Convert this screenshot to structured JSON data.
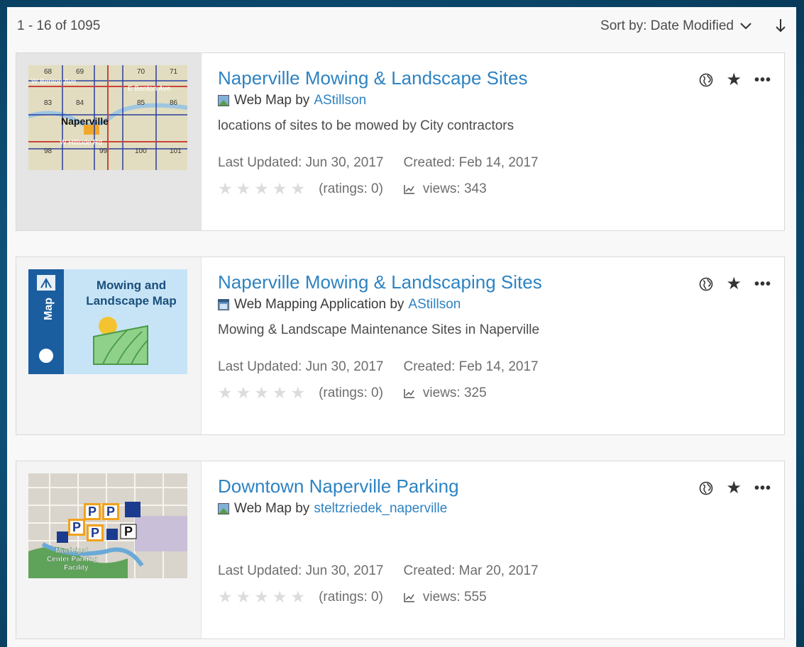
{
  "header": {
    "count": "1 - 16 of 1095",
    "sort_label": "Sort by: Date Modified"
  },
  "items": [
    {
      "title": "Naperville Mowing & Landscape Sites",
      "type": "Web Map by",
      "owner": "AStillson",
      "description": "locations of sites to be mowed by City contractors",
      "updated": "Last Updated: Jun 30, 2017",
      "created": "Created: Feb 14, 2017",
      "stars": "★★★★★",
      "ratings": "(ratings: 0)",
      "views": "views: 343",
      "thumb": {
        "labels": [
          "68",
          "69",
          "70",
          "71",
          "W Benton Ave",
          "E Benton Ave",
          "83",
          "84",
          "85",
          "86",
          "Naperville",
          "98",
          "W Hillside Rd",
          "99",
          "100",
          "101"
        ]
      }
    },
    {
      "title": "Naperville Mowing & Landscaping Sites",
      "type": "Web Mapping Application by",
      "owner": "AStillson",
      "description": "Mowing & Landscape Maintenance Sites in Naperville",
      "updated": "Last Updated: Jun 30, 2017",
      "created": "Created: Feb 14, 2017",
      "stars": "★★★★★",
      "ratings": "(ratings: 0)",
      "views": "views: 325",
      "thumb": {
        "line1": "Mowing and",
        "line2": "Landscape Map",
        "side": "Map"
      }
    },
    {
      "title": "Downtown Naperville Parking",
      "type": "Web Map by",
      "owner": "steltzriedek_naperville",
      "description": "",
      "updated": "Last Updated: Jun 30, 2017",
      "created": "Created: Mar 20, 2017",
      "stars": "★★★★★",
      "ratings": "(ratings: 0)",
      "views": "views: 555",
      "thumb": {
        "p": "P",
        "label1": "Municipal",
        "label2": "Center Parking",
        "label3": "Facility"
      }
    }
  ],
  "icons": {
    "sort_chevron": "chevron-down-icon",
    "sort_direction": "arrow-down-icon",
    "share": "globe-icon",
    "favorite": "star-icon",
    "more": "ellipsis-icon",
    "views": "chart-icon",
    "webmap": "web-map-icon",
    "webapp": "web-app-icon"
  },
  "colors": {
    "link": "#2e83c2",
    "star_empty": "#dcdcdc",
    "background": "#0d4e74"
  }
}
